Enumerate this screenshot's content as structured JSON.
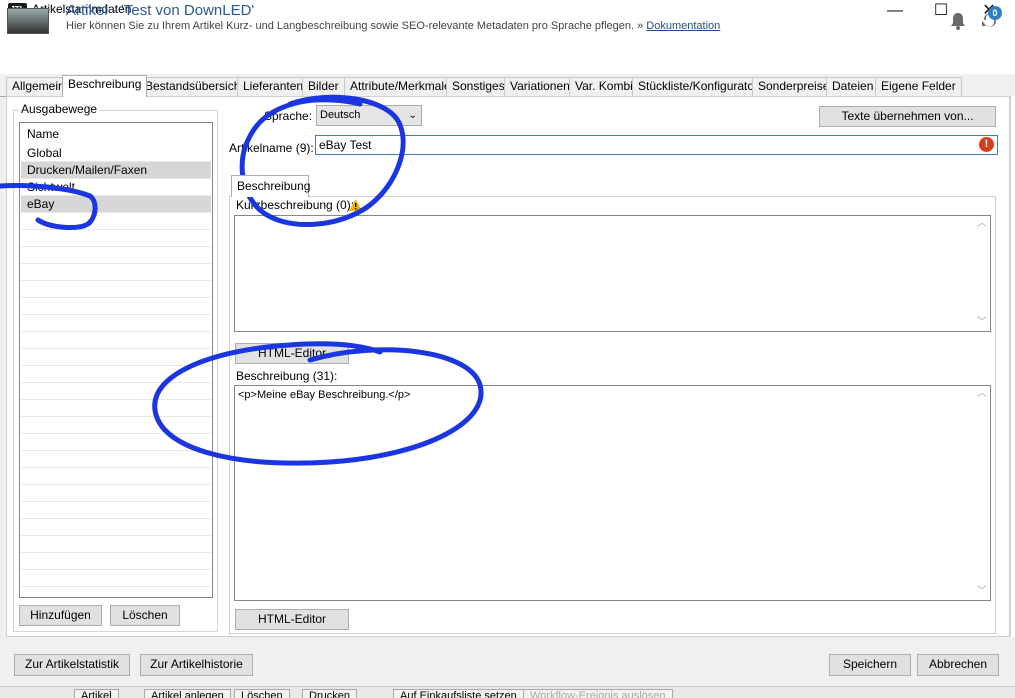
{
  "window": {
    "title": "Artikelstammdaten",
    "logo_text": "JTL",
    "minimize": "—",
    "maximize": "☐",
    "close": "✕"
  },
  "header": {
    "title": "Artikel - 'Test von DownLED'",
    "description": "Hier können Sie zu Ihrem Artikel Kurz- und Langbeschreibung sowie SEO-relevante Metadaten pro Sprache pflegen. »",
    "doc_link": "Dokumentation",
    "badge": "0"
  },
  "tabs": [
    {
      "label": "Allgemein",
      "active": false
    },
    {
      "label": "Beschreibung",
      "active": true
    },
    {
      "label": "Bestandsübersicht",
      "active": false
    },
    {
      "label": "Lieferanten",
      "active": false
    },
    {
      "label": "Bilder",
      "active": false
    },
    {
      "label": "Attribute/Merkmale",
      "active": false
    },
    {
      "label": "Sonstiges",
      "active": false
    },
    {
      "label": "Variationen",
      "active": false
    },
    {
      "label": "Var. Kombi",
      "active": false
    },
    {
      "label": "Stückliste/Konfigurator",
      "active": false
    },
    {
      "label": "Sonderpreise",
      "active": false
    },
    {
      "label": "Dateien",
      "active": false
    },
    {
      "label": "Eigene Felder",
      "active": false
    }
  ],
  "ausgabewege": {
    "label": "Ausgabewege",
    "column_header": "Name",
    "items": [
      {
        "label": "Global",
        "selected": false
      },
      {
        "label": "Drucken/Mailen/Faxen",
        "selected": true
      },
      {
        "label": "Sichtwelt",
        "selected": false
      },
      {
        "label": "eBay",
        "selected": true
      }
    ],
    "add_button": "Hinzufügen",
    "delete_button": "Löschen"
  },
  "sprache": {
    "label": "Sprache:",
    "value": "Deutsch"
  },
  "copy_button": "Texte übernehmen von...",
  "artikelname": {
    "label": "Artikelname (9):",
    "value": "eBay Test"
  },
  "inner_tab": "Beschreibung",
  "kurzbeschreibung": {
    "label": "Kurzbeschreibung (0):",
    "value": ""
  },
  "html_editor_1": "HTML-Editor",
  "beschreibung": {
    "label": "Beschreibung (31):",
    "value": "<p>Meine eBay Beschreibung.</p>"
  },
  "html_editor_2": "HTML-Editor",
  "footer": {
    "stats_button": "Zur Artikelstatistik",
    "history_button": "Zur Artikelhistorie",
    "save_button": "Speichern",
    "cancel_button": "Abbrechen"
  },
  "taskbar": [
    {
      "label": "Artikel",
      "disabled": false
    },
    {
      "label": "Artikel anlegen",
      "disabled": false
    },
    {
      "label": "Löschen",
      "disabled": false
    },
    {
      "label": "Drucken",
      "disabled": false
    },
    {
      "label": "Auf Einkaufsliste setzen",
      "disabled": false
    },
    {
      "label": "Workflow-Ereignis auslösen",
      "disabled": true
    }
  ],
  "colors": {
    "accent": "#2b5797",
    "annotation": "#1a36e0",
    "error": "#d83c1b"
  }
}
